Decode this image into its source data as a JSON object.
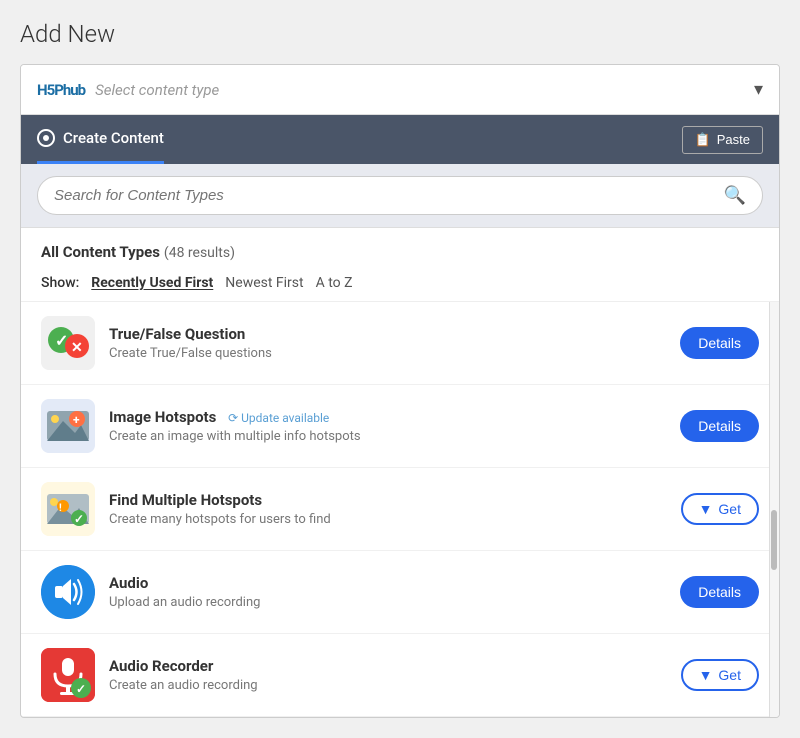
{
  "page": {
    "title": "Add New"
  },
  "select_bar": {
    "logo": "H5Phub",
    "placeholder": "Select content type",
    "chevron": "▾"
  },
  "tab_bar": {
    "tab_label": "Create Content",
    "paste_label": "Paste",
    "paste_icon": "📋"
  },
  "search": {
    "placeholder": "Search for Content Types"
  },
  "list_header": {
    "title": "All Content Types",
    "count": "(48 results)",
    "show_label": "Show:",
    "sort_options": [
      {
        "label": "Recently Used First",
        "active": true
      },
      {
        "label": "Newest First",
        "active": false
      },
      {
        "label": "A to Z",
        "active": false
      }
    ]
  },
  "items": [
    {
      "id": "true-false",
      "name": "True/False Question",
      "description": "Create True/False questions",
      "button_type": "details",
      "button_label": "Details",
      "has_update": false
    },
    {
      "id": "image-hotspots",
      "name": "Image Hotspots",
      "description": "Create an image with multiple info hotspots",
      "button_type": "details",
      "button_label": "Details",
      "has_update": true,
      "update_text": "Update available"
    },
    {
      "id": "find-hotspots",
      "name": "Find Multiple Hotspots",
      "description": "Create many hotspots for users to find",
      "button_type": "get",
      "button_label": "Get",
      "has_update": false
    },
    {
      "id": "audio",
      "name": "Audio",
      "description": "Upload an audio recording",
      "button_type": "details",
      "button_label": "Details",
      "has_update": false
    },
    {
      "id": "audio-recorder",
      "name": "Audio Recorder",
      "description": "Create an audio recording",
      "button_type": "get",
      "button_label": "Get",
      "has_update": false
    }
  ],
  "colors": {
    "accent": "#2563eb",
    "tab_bg": "#4a5568",
    "search_bg": "#e8eaf0"
  }
}
